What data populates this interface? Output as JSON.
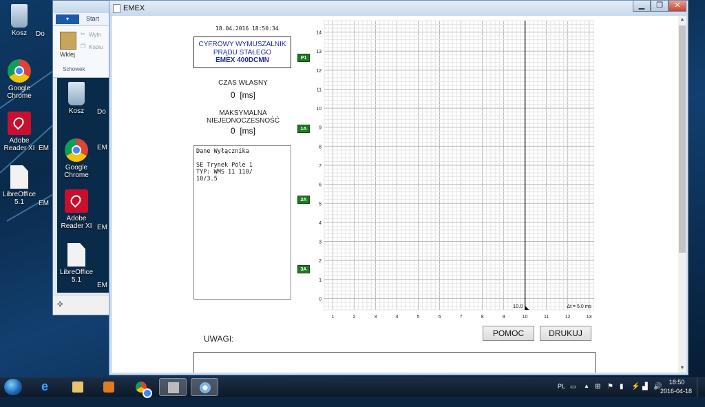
{
  "desktop": {
    "icons": [
      {
        "label": "Kosz",
        "icon": "recycle-bin-icon"
      },
      {
        "label": "Google Chrome",
        "icon": "chrome-icon"
      },
      {
        "label": "Adobe Reader XI",
        "icon": "pdf-icon"
      },
      {
        "label": "LibreOffice 5.1",
        "icon": "document-icon"
      }
    ],
    "partial_labels": [
      "Do",
      "EM",
      "EM"
    ]
  },
  "explorer": {
    "file_tab": "",
    "start_tab": "Start",
    "cut_label": "Wytn",
    "copy_label": "Kopiu",
    "paste_label": "Wklej",
    "group_label": "Schowek",
    "content_icons": [
      {
        "label": "Kosz"
      },
      {
        "label": "Google Chrome"
      },
      {
        "label": "Adobe Reader XI"
      },
      {
        "label": "LibreOffice 5.1"
      }
    ],
    "content_partial_labels": [
      "Do",
      "EM",
      "EM",
      "EM"
    ]
  },
  "window": {
    "title": "EMEX",
    "controls": [
      "minimize",
      "maximize",
      "close"
    ]
  },
  "panel": {
    "datetime": "18.04.2016 18:50:34",
    "device_line1": "CYFROWY WYMUSZALNIK",
    "device_line2": "PRĄDU STAŁEGO",
    "device_line3": "EMEX 400DCMN",
    "own_time_label": "CZAS WŁASNY",
    "own_time_value": "0",
    "own_time_unit": "[ms]",
    "max_label_1": "MAKSYMALNA",
    "max_label_2": "NIEJEDNOCZESNOŚĆ",
    "max_value": "0",
    "max_unit": "[ms]",
    "breaker_text": "Dane Wyłącznika\n\nSE Trynek Pole 1\nTYP: WMS 11 110/\n10/3.5",
    "markers": [
      "P1",
      "1A",
      "2A",
      "3A"
    ],
    "uwagi_label": "UWAGI:",
    "help_button": "POMOC",
    "print_button": "DRUKUJ"
  },
  "chart_data": {
    "type": "line",
    "x_ticks": [
      "1",
      "2",
      "3",
      "4",
      "5",
      "6",
      "7",
      "8",
      "9",
      "10",
      "11",
      "12",
      "13"
    ],
    "y_ticks": [
      "0",
      "1",
      "2",
      "3",
      "4",
      "5",
      "6",
      "7",
      "8",
      "9",
      "10",
      "11",
      "12",
      "13",
      "14"
    ],
    "xlim": [
      0.6,
      13.3
    ],
    "ylim": [
      -0.6,
      14.6
    ],
    "cursor_x": 10,
    "cursor_label": "10.0",
    "dt_label": "Δt = 5.0 ms",
    "grid": true
  },
  "taskbar": {
    "language": "PL",
    "time": "18:50",
    "date": "2016-04-18",
    "apps": [
      "start-orb",
      "internet-explorer-icon",
      "file-explorer-icon",
      "media-player-icon",
      "chrome-icon",
      "emex-app-icon",
      "paint-icon"
    ]
  }
}
